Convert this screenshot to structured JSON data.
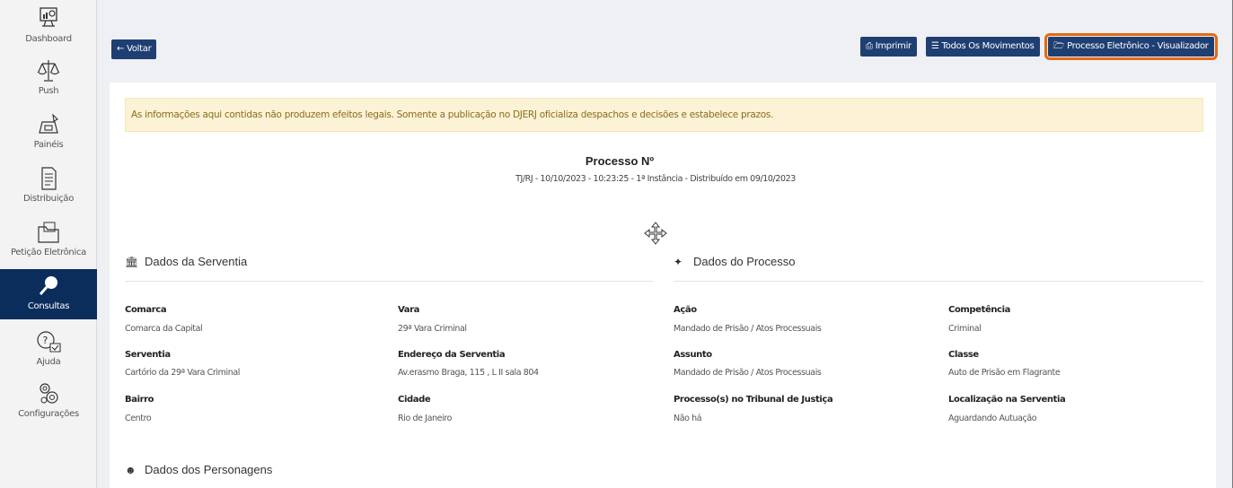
{
  "sidebar": {
    "items": [
      {
        "label": "Dashboard",
        "icon": "dashboard-icon"
      },
      {
        "label": "Push",
        "icon": "scales-icon"
      },
      {
        "label": "Painéis",
        "icon": "panels-icon"
      },
      {
        "label": "Distribuição",
        "icon": "document-icon"
      },
      {
        "label": "Petição Eletrônica",
        "icon": "folder-icon"
      },
      {
        "label": "Consultas",
        "icon": "search-icon"
      },
      {
        "label": "Ajuda",
        "icon": "help-icon"
      },
      {
        "label": "Configurações",
        "icon": "gears-icon"
      }
    ],
    "active": "Consultas"
  },
  "toolbar": {
    "back_label": "Voltar",
    "print_label": "Imprimir",
    "movements_label": "Todos Os Movimentos",
    "viewer_label": "Processo Eletrônico - Visualizador"
  },
  "alert": {
    "text": "As informações aqui contidas não produzem efeitos legais. Somente a publicação no DJERJ oficializa despachos e decisões e estabelece prazos."
  },
  "process": {
    "title": "Processo Nº",
    "subtitle": "TJ/RJ - 10/10/2023 - 10:23:25 - 1ª Instância - Distribuído em 09/10/2023"
  },
  "serventia": {
    "heading": "Dados da Serventia",
    "fields": [
      {
        "label": "Comarca",
        "value": "Comarca da Capital"
      },
      {
        "label": "Vara",
        "value": "29ª Vara Criminal"
      },
      {
        "label": "Serventia",
        "value": "Cartório da 29ª Vara Criminal"
      },
      {
        "label": "Endereço da Serventia",
        "value": "Av.erasmo Braga, 115 , L II sala 804"
      },
      {
        "label": "Bairro",
        "value": "Centro"
      },
      {
        "label": "Cidade",
        "value": "Rio de Janeiro"
      }
    ]
  },
  "processo": {
    "heading": "Dados do Processo",
    "fields": [
      {
        "label": "Ação",
        "value": "Mandado de Prisão / Atos Processuais"
      },
      {
        "label": "Competência",
        "value": "Criminal"
      },
      {
        "label": "Assunto",
        "value": "Mandado de Prisão / Atos Processuais"
      },
      {
        "label": "Classe",
        "value": "Auto de Prisão em Flagrante"
      },
      {
        "label": "Processo(s) no Tribunal de Justiça",
        "value": "Não há"
      },
      {
        "label": "Localização na Serventia",
        "value": "Aguardando Autuação"
      }
    ]
  },
  "personagens": {
    "heading": "Dados dos Personagens"
  },
  "colors": {
    "sidebar_active": "#0b2d5c",
    "button": "#1f3f73",
    "highlight": "#e46a12",
    "alert_bg": "#fcf2d5",
    "alert_text": "#8a6d1e"
  }
}
